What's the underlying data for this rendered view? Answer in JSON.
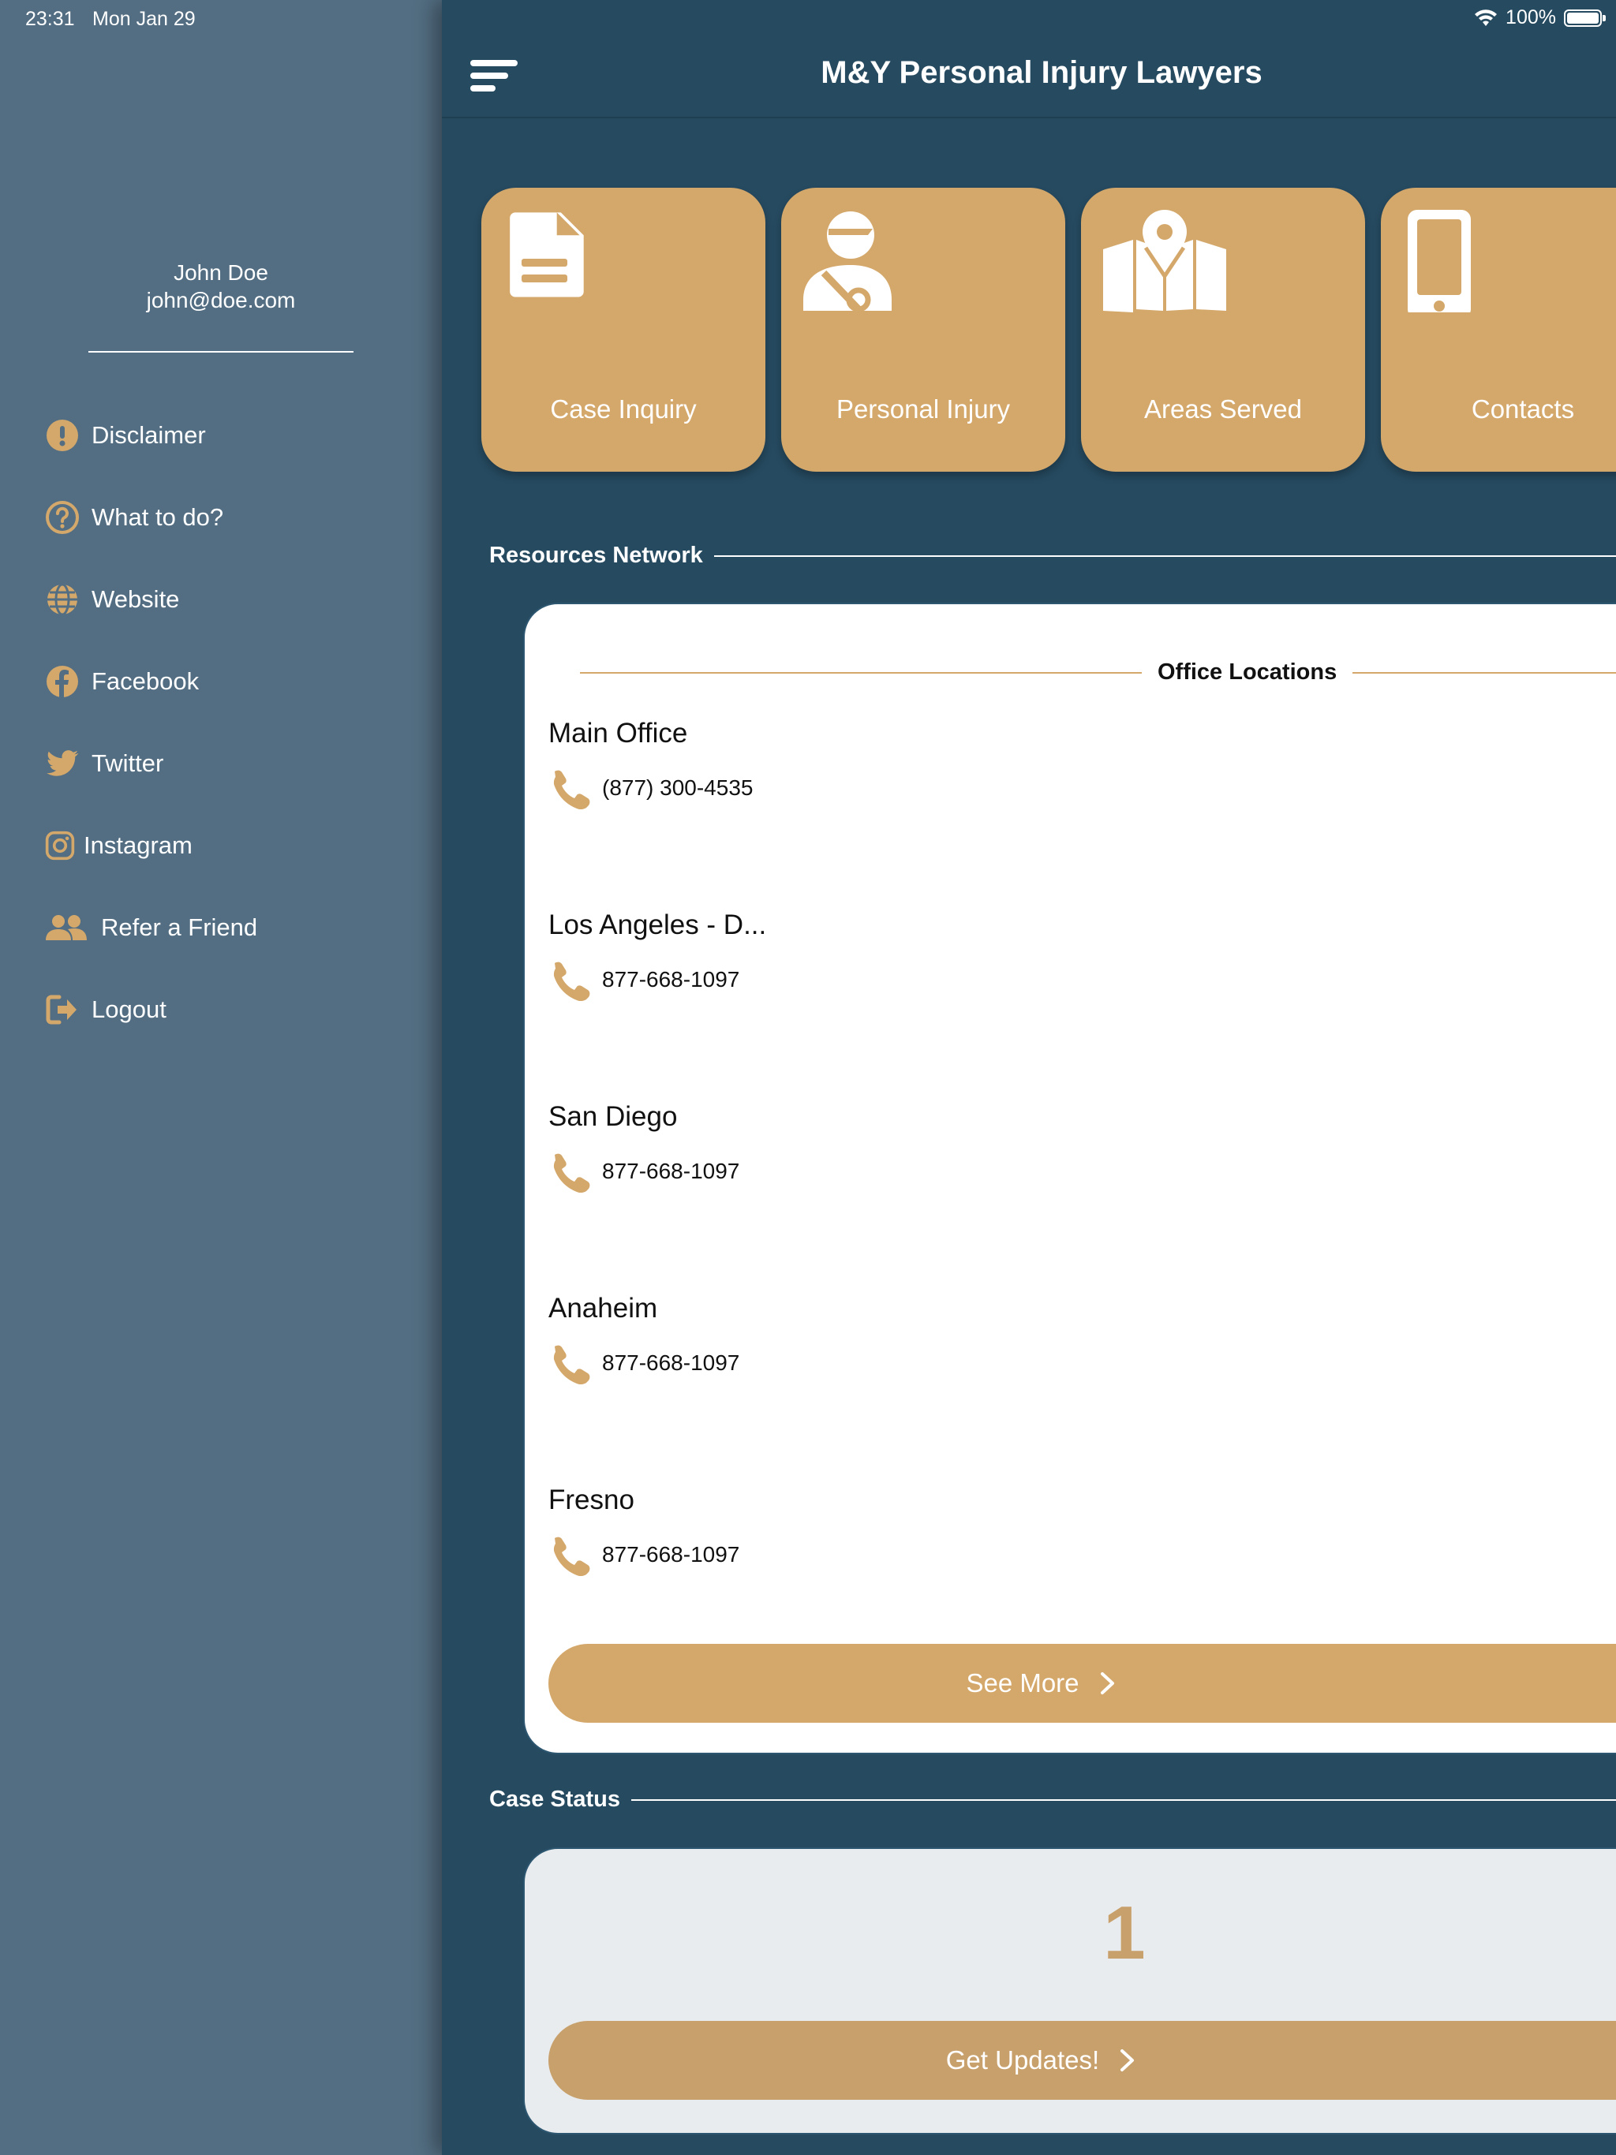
{
  "status_bar": {
    "time": "23:31",
    "date": "Mon Jan 29",
    "battery": "100%",
    "battery_level": 1.0
  },
  "sidebar": {
    "user_name": "John Doe",
    "user_email": "john@doe.com",
    "items": [
      {
        "label": "Disclaimer",
        "icon": "exclamation-circle-icon"
      },
      {
        "label": "What to do?",
        "icon": "question-circle-icon"
      },
      {
        "label": "Website",
        "icon": "globe-icon"
      },
      {
        "label": "Facebook",
        "icon": "facebook-icon"
      },
      {
        "label": "Twitter",
        "icon": "twitter-icon"
      },
      {
        "label": "Instagram",
        "icon": "instagram-icon"
      },
      {
        "label": "Refer a Friend",
        "icon": "users-icon"
      },
      {
        "label": "Logout",
        "icon": "logout-icon"
      }
    ]
  },
  "header": {
    "title": "M&Y Personal Injury Lawyers"
  },
  "tiles": [
    {
      "label": "Case Inquiry",
      "icon": "document-icon"
    },
    {
      "label": "Personal Injury",
      "icon": "injured-person-icon"
    },
    {
      "label": "Areas Served",
      "icon": "map-icon"
    },
    {
      "label": "Contacts",
      "icon": "mobile-phone-icon"
    }
  ],
  "resources": {
    "section_title": "Resources Network",
    "card_title": "Office Locations",
    "offices": [
      {
        "name": "Main Office",
        "phone": "(877) 300-4535"
      },
      {
        "name": "Los Angeles - D...",
        "phone": "877-668-1097"
      },
      {
        "name": "San Diego",
        "phone": "877-668-1097"
      },
      {
        "name": "Anaheim",
        "phone": "877-668-1097"
      },
      {
        "name": "Fresno",
        "phone": "877-668-1097"
      }
    ],
    "see_more_label": "See More"
  },
  "case_status": {
    "section_title": "Case Status",
    "count": "1",
    "button_label": "Get Updates!"
  },
  "colors": {
    "accent": "#d4a86b",
    "background": "#264a60",
    "sidebar": "#536e82"
  }
}
